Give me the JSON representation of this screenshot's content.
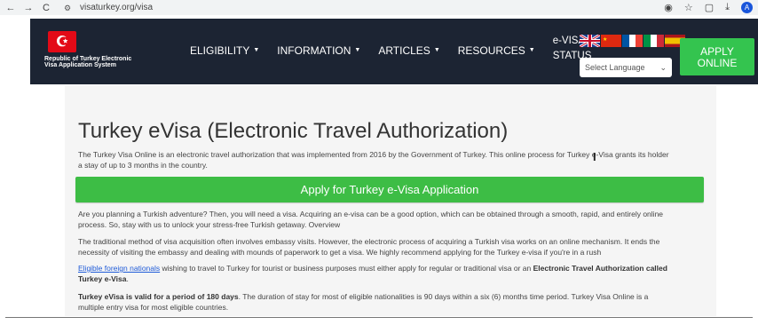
{
  "browser": {
    "back": "←",
    "forward": "→",
    "reload": "C",
    "url": "visaturkey.org/visa",
    "profile_initial": "A"
  },
  "header": {
    "logo_symbol": "☪",
    "logo_line1": "Republic of Turkey Electronic",
    "logo_line2": "Visa Application System",
    "menu": [
      {
        "label": "ELIGIBILITY"
      },
      {
        "label": "INFORMATION"
      },
      {
        "label": "ARTICLES"
      },
      {
        "label": "RESOURCES"
      }
    ],
    "evisa_line1": "e-VISA",
    "evisa_line2": "STATUS",
    "language_placeholder": "Select Language",
    "apply_line1": "APPLY",
    "apply_line2": "ONLINE",
    "apply_color": "#34c44f"
  },
  "main": {
    "title": "Turkey eVisa (Electronic Travel Authorization)",
    "intro_1": "The Turkey Visa Online is an electronic travel authorization that was implemented from 2016 by the Government of Turkey. This online process for Turkey e-Visa grants its holder",
    "intro_2": "a stay of up to 3 months in the country.",
    "cta_label": "Apply for Turkey e-Visa Application",
    "cta_color": "#3dbd45",
    "p1_1": "Are you planning a Turkish adventure? Then, you will need a visa. Acquiring an e-visa can be a good option, which can be obtained through a smooth, rapid, and entirely online",
    "p1_2": "process. So, stay with us to unlock your stress-free Turkish getaway. Overview",
    "p2_1": "The traditional method of visa acquisition often involves embassy visits. However, the electronic process of acquiring a Turkish visa works on an online mechanism. It ends the",
    "p2_2": "necessity of visiting the embassy and dealing with mounds of paperwork to get a visa. We highly recommend applying for the Turkey e-visa if you're in a rush",
    "p3_link": "Eligible foreign nationals",
    "p3_text": " wishing to travel to Turkey for tourist or business purposes must either apply for regular or traditional visa or an ",
    "p3_bold1": "Electronic Travel Authorization called",
    "p3_bold2": "Turkey e-Visa",
    "p3_end": ".",
    "p4_bold": "Turkey eVisa is valid for a period of 180 days",
    "p4_text": ". The duration of stay for most of eligible nationalities is 90 days within a six (6) months time period. Turkey Visa Online is a",
    "p4_line2": "multiple entry visa for most eligible countries."
  }
}
